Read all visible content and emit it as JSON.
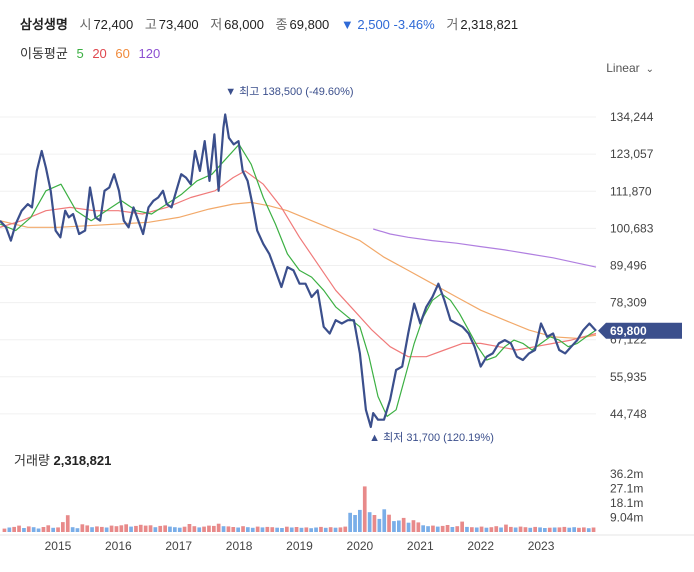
{
  "header": {
    "name": "삼성생명",
    "open_label": "시",
    "open": "72,400",
    "high_label": "고",
    "high": "73,400",
    "low_label": "저",
    "low": "68,000",
    "close_label": "종",
    "close": "69,800",
    "change": "▼ 2,500 -3.46%",
    "volume_label": "거",
    "volume": "2,318,821"
  },
  "ma_legend": {
    "title": "이동평균",
    "ma5": "5",
    "ma20": "20",
    "ma60": "60",
    "ma120": "120"
  },
  "scale_toggle": {
    "label": "Linear",
    "icon": "chevron-down-icon"
  },
  "volume_panel": {
    "label": "거래량",
    "value": "2,318,821"
  },
  "colors": {
    "price": "#3b4f8c",
    "ma5": "#3cb043",
    "ma20": "#f07a7a",
    "ma60": "#f2a96a",
    "ma120": "#b07fe0",
    "vol_up": "#e88a8a",
    "vol_down": "#7aaee8",
    "badge": "#3b4f8c"
  },
  "chart_data": {
    "type": "line",
    "y_ticks": [
      44748,
      55935,
      67122,
      78309,
      89496,
      100683,
      111870,
      123057,
      134244
    ],
    "y_tick_labels": [
      "44,748",
      "55,935",
      "67,122",
      "78,309",
      "89,496",
      "100,683",
      "111,870",
      "123,057",
      "134,244"
    ],
    "ylim": [
      40500,
      143000
    ],
    "x_ticks": [
      2015,
      2016,
      2017,
      2018,
      2019,
      2020,
      2021,
      2022,
      2023
    ],
    "xlim": [
      2014.04,
      2023.91
    ],
    "last_price_badge": "69,800",
    "max_annotation": {
      "x": 2017.77,
      "y": 138500,
      "label": "최고 138,500 (-49.60%)"
    },
    "min_annotation": {
      "x": 2020.22,
      "y": 31700,
      "label": "최저 31,700 (120.19%)"
    },
    "series": [
      {
        "id": "price",
        "x": [
          2014.04,
          2014.14,
          2014.22,
          2014.3,
          2014.4,
          2014.5,
          2014.57,
          2014.65,
          2014.73,
          2014.8,
          2014.88,
          2014.96,
          2015.04,
          2015.12,
          2015.18,
          2015.25,
          2015.35,
          2015.45,
          2015.53,
          2015.62,
          2015.7,
          2015.77,
          2015.85,
          2015.93,
          2016.01,
          2016.09,
          2016.17,
          2016.25,
          2016.33,
          2016.41,
          2016.5,
          2016.58,
          2016.66,
          2016.74,
          2016.8,
          2016.88,
          2016.96,
          2017.04,
          2017.12,
          2017.2,
          2017.27,
          2017.35,
          2017.43,
          2017.51,
          2017.59,
          2017.66,
          2017.74,
          2017.77,
          2017.83,
          2017.91,
          2017.99,
          2018.06,
          2018.14,
          2018.22,
          2018.3,
          2018.4,
          2018.5,
          2018.6,
          2018.7,
          2018.8,
          2018.9,
          2019.0,
          2019.1,
          2019.2,
          2019.3,
          2019.4,
          2019.5,
          2019.6,
          2019.7,
          2019.8,
          2019.9,
          2020.0,
          2020.1,
          2020.18,
          2020.22,
          2020.3,
          2020.4,
          2020.5,
          2020.6,
          2020.7,
          2020.8,
          2020.9,
          2021.0,
          2021.1,
          2021.2,
          2021.3,
          2021.4,
          2021.5,
          2021.6,
          2021.7,
          2021.8,
          2021.9,
          2022.0,
          2022.1,
          2022.2,
          2022.3,
          2022.4,
          2022.5,
          2022.6,
          2022.7,
          2022.8,
          2022.9,
          2023.0,
          2023.1,
          2023.2,
          2023.3,
          2023.4,
          2023.5,
          2023.6,
          2023.7,
          2023.8,
          2023.91
        ],
        "y": [
          103000,
          101000,
          97000,
          102000,
          106000,
          108000,
          107000,
          118000,
          124000,
          119000,
          112000,
          100000,
          98000,
          106000,
          104000,
          105000,
          99000,
          100000,
          113000,
          104000,
          103000,
          112000,
          113000,
          117000,
          112000,
          103000,
          101000,
          107000,
          103000,
          99000,
          107000,
          109000,
          110000,
          112000,
          108000,
          107000,
          112000,
          117000,
          116000,
          114000,
          124000,
          118000,
          127000,
          115000,
          129000,
          112000,
          131000,
          135000,
          128000,
          126000,
          127000,
          118000,
          115000,
          108000,
          100000,
          96000,
          93000,
          88000,
          83000,
          89000,
          88000,
          84000,
          84000,
          80000,
          82000,
          71000,
          69000,
          73000,
          72000,
          73000,
          73000,
          63000,
          46000,
          40800,
          45000,
          43000,
          43000,
          49000,
          58000,
          59000,
          69000,
          78000,
          72000,
          77000,
          80000,
          84000,
          79000,
          73000,
          72000,
          71000,
          69000,
          65000,
          59000,
          62000,
          63000,
          66000,
          67000,
          66000,
          62000,
          61000,
          63000,
          64000,
          72000,
          68000,
          69000,
          64000,
          63000,
          65000,
          67000,
          70000,
          72000,
          69800
        ]
      },
      {
        "id": "ma5",
        "x": [
          2014.04,
          2014.3,
          2014.55,
          2014.8,
          2015.05,
          2015.3,
          2015.55,
          2015.8,
          2016.05,
          2016.3,
          2016.55,
          2016.8,
          2017.05,
          2017.3,
          2017.55,
          2017.8,
          2018.0,
          2018.2,
          2018.4,
          2018.6,
          2018.8,
          2019.0,
          2019.2,
          2019.4,
          2019.6,
          2019.8,
          2020.0,
          2020.15,
          2020.3,
          2020.45,
          2020.6,
          2020.75,
          2020.9,
          2021.05,
          2021.2,
          2021.35,
          2021.5,
          2021.65,
          2021.8,
          2021.95,
          2022.1,
          2022.25,
          2022.4,
          2022.55,
          2022.7,
          2022.85,
          2023.0,
          2023.15,
          2023.3,
          2023.45,
          2023.6,
          2023.75,
          2023.91
        ],
        "y": [
          102000,
          100000,
          104000,
          112000,
          114000,
          106000,
          103000,
          106000,
          109000,
          106000,
          105000,
          108000,
          111000,
          115000,
          117000,
          122000,
          126000,
          120000,
          110000,
          102000,
          93000,
          88000,
          86000,
          82000,
          77000,
          74000,
          71000,
          62000,
          50000,
          44000,
          46000,
          56000,
          66000,
          74000,
          79000,
          81000,
          79000,
          75000,
          70000,
          65000,
          61000,
          62000,
          65000,
          67000,
          66000,
          64000,
          66000,
          68000,
          67000,
          65000,
          66000,
          68000,
          70000
        ]
      },
      {
        "id": "ma20",
        "x": [
          2014.04,
          2014.4,
          2014.8,
          2015.2,
          2015.6,
          2016.0,
          2016.4,
          2016.8,
          2017.2,
          2017.6,
          2017.9,
          2018.1,
          2018.4,
          2018.7,
          2019.0,
          2019.3,
          2019.6,
          2019.9,
          2020.2,
          2020.5,
          2020.8,
          2021.1,
          2021.4,
          2021.7,
          2022.0,
          2022.3,
          2022.6,
          2022.9,
          2023.2,
          2023.5,
          2023.91
        ],
        "y": [
          101000,
          103000,
          106000,
          107000,
          106000,
          106000,
          105000,
          107000,
          110000,
          112000,
          116000,
          118000,
          114000,
          107000,
          98000,
          90000,
          82000,
          76000,
          70000,
          65000,
          62000,
          62000,
          64000,
          66000,
          66000,
          65000,
          64000,
          65000,
          66000,
          67000,
          69000
        ]
      },
      {
        "id": "ma60",
        "x": [
          2014.04,
          2014.5,
          2015.0,
          2015.5,
          2016.0,
          2016.5,
          2017.0,
          2017.5,
          2017.9,
          2018.2,
          2018.5,
          2018.8,
          2019.2,
          2019.6,
          2020.0,
          2020.4,
          2020.8,
          2021.2,
          2021.6,
          2022.0,
          2022.4,
          2022.8,
          2023.2,
          2023.6,
          2023.91
        ],
        "y": [
          103000,
          101000,
          101000,
          101500,
          102000,
          102500,
          104000,
          106500,
          108000,
          108500,
          107500,
          106000,
          103000,
          100000,
          97000,
          92000,
          88000,
          84000,
          80000,
          76000,
          73000,
          70000,
          68000,
          67500,
          68500
        ]
      },
      {
        "id": "ma120",
        "x": [
          2020.22,
          2020.5,
          2020.8,
          2021.2,
          2021.6,
          2022.0,
          2022.4,
          2022.8,
          2023.2,
          2023.6,
          2023.91
        ],
        "y": [
          100500,
          99000,
          98000,
          97000,
          96200,
          95200,
          94200,
          93000,
          91800,
          90200,
          89000
        ]
      }
    ],
    "volume": {
      "y_ticks": [
        9.04,
        18.1,
        27.1,
        36.2
      ],
      "y_tick_labels": [
        "9.04m",
        "18.1m",
        "27.1m",
        "36.2m"
      ],
      "ylim": [
        0,
        40
      ],
      "values": [
        2.1,
        2.8,
        3.2,
        4.0,
        2.5,
        3.5,
        3.0,
        2.2,
        3.1,
        4.2,
        2.6,
        2.9,
        6.2,
        10.5,
        3.0,
        2.4,
        4.8,
        4.1,
        3.0,
        3.5,
        3.2,
        2.8,
        4.0,
        3.6,
        4.2,
        4.8,
        3.4,
        3.8,
        4.5,
        4.0,
        4.2,
        3.0,
        3.8,
        4.1,
        3.4,
        3.0,
        2.7,
        3.3,
        5.0,
        3.6,
        2.9,
        3.4,
        4.0,
        3.8,
        5.2,
        3.6,
        3.5,
        3.1,
        2.8,
        3.6,
        3.0,
        2.6,
        3.4,
        2.9,
        3.2,
        3.0,
        2.7,
        2.5,
        3.3,
        2.8,
        3.1,
        2.6,
        2.9,
        2.4,
        2.8,
        3.2,
        2.6,
        3.0,
        2.7,
        2.9,
        3.4,
        12.0,
        10.6,
        13.8,
        28.5,
        12.4,
        10.6,
        8.2,
        14.2,
        10.8,
        6.8,
        7.2,
        8.8,
        5.8,
        7.4,
        6.0,
        4.2,
        3.6,
        4.0,
        3.4,
        3.8,
        4.4,
        3.1,
        3.6,
        6.5,
        3.2,
        3.0,
        2.8,
        3.4,
        2.7,
        3.0,
        3.6,
        2.8,
        4.6,
        3.2,
        2.8,
        3.4,
        3.0,
        2.6,
        3.2,
        2.9,
        2.5,
        2.7,
        2.8,
        2.9,
        3.2,
        2.7,
        3.0,
        2.6,
        2.9,
        2.4,
        2.8
      ],
      "up": [
        1,
        0,
        1,
        1,
        0,
        1,
        0,
        0,
        1,
        1,
        0,
        1,
        1,
        1,
        0,
        0,
        1,
        1,
        0,
        1,
        1,
        0,
        1,
        1,
        1,
        1,
        0,
        1,
        1,
        1,
        1,
        0,
        1,
        1,
        0,
        0,
        0,
        1,
        1,
        1,
        0,
        1,
        1,
        1,
        1,
        0,
        1,
        1,
        0,
        1,
        0,
        0,
        1,
        0,
        1,
        1,
        0,
        0,
        1,
        0,
        1,
        0,
        1,
        0,
        0,
        1,
        0,
        1,
        0,
        1,
        1,
        0,
        0,
        0,
        1,
        0,
        1,
        0,
        0,
        1,
        0,
        0,
        1,
        0,
        1,
        1,
        0,
        0,
        1,
        0,
        1,
        1,
        0,
        1,
        1,
        0,
        1,
        0,
        1,
        0,
        1,
        1,
        0,
        1,
        1,
        0,
        1,
        1,
        0,
        1,
        0,
        0,
        1,
        0,
        1,
        1,
        0,
        0,
        1,
        1,
        0,
        1
      ]
    }
  }
}
